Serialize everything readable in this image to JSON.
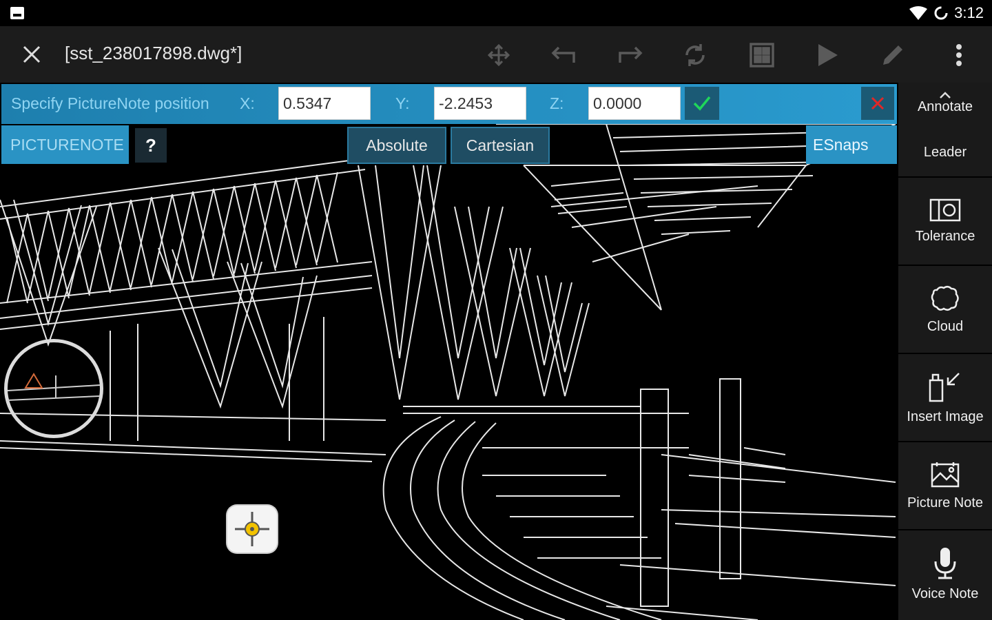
{
  "status_bar": {
    "time": "3:12"
  },
  "toolbar": {
    "file_title": "[sst_238017898.dwg*]",
    "icons": [
      "close-icon",
      "move-icon",
      "undo-icon",
      "redo-icon",
      "sync-icon",
      "grid-icon",
      "play-icon",
      "pencil-icon",
      "more-icon"
    ]
  },
  "command": {
    "prompt": "Specify PictureNote position",
    "x_label": "X:",
    "x_value": "0.5347",
    "y_label": "Y:",
    "y_value": "-2.2453",
    "z_label": "Z:",
    "z_value": "0.0000",
    "name": "PICTURENOTE",
    "help": "?",
    "absolute": "Absolute",
    "cartesian": "Cartesian",
    "esnaps": "ESnaps"
  },
  "right_panel": {
    "tab_annotate": "Annotate",
    "tab_leader": "Leader",
    "items": [
      {
        "label": "Tolerance",
        "icon": "tolerance-icon"
      },
      {
        "label": "Cloud",
        "icon": "cloud-icon"
      },
      {
        "label": "Insert Image",
        "icon": "insert-image-icon"
      },
      {
        "label": "Picture Note",
        "icon": "picture-note-icon"
      },
      {
        "label": "Voice Note",
        "icon": "voice-note-icon"
      }
    ]
  },
  "colors": {
    "command_bar": "#2a9bcf",
    "accent_green": "#1fd65a",
    "accent_red": "#e02828",
    "snap_yellow": "#f2c200"
  }
}
